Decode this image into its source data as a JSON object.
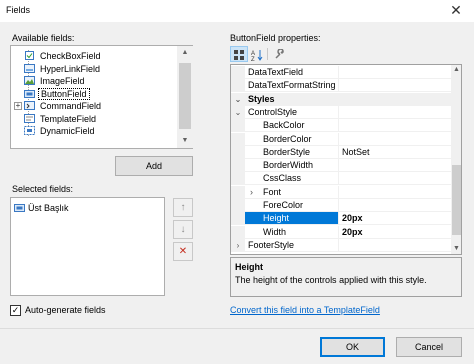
{
  "window": {
    "title": "Fields",
    "close_glyph": "✕"
  },
  "available": {
    "label": "Available fields:",
    "items": [
      {
        "label": "CheckBoxField",
        "icon": "checkbox-field-icon",
        "expandable": false,
        "selected": false
      },
      {
        "label": "HyperLinkField",
        "icon": "hyperlink-field-icon",
        "expandable": false,
        "selected": false
      },
      {
        "label": "ImageField",
        "icon": "image-field-icon",
        "expandable": false,
        "selected": false
      },
      {
        "label": "ButtonField",
        "icon": "button-field-icon",
        "expandable": false,
        "selected": true
      },
      {
        "label": "CommandField",
        "icon": "command-field-icon",
        "expandable": true,
        "selected": false
      },
      {
        "label": "TemplateField",
        "icon": "template-field-icon",
        "expandable": false,
        "selected": false
      },
      {
        "label": "DynamicField",
        "icon": "dynamic-field-icon",
        "expandable": false,
        "selected": false
      }
    ],
    "add_label": "Add"
  },
  "selected": {
    "label": "Selected fields:",
    "items": [
      {
        "label": "Üst Başlık",
        "icon": "button-field-icon"
      }
    ],
    "move_up": "↑",
    "move_down": "↓",
    "delete": "✕"
  },
  "autogen": {
    "label": "Auto-generate fields",
    "checked": true
  },
  "properties": {
    "label": "ButtonField properties:",
    "rows": [
      {
        "type": "prop",
        "name": "DataTextField",
        "value": ""
      },
      {
        "type": "prop",
        "name": "DataTextFormatString",
        "value": ""
      },
      {
        "type": "cat",
        "name": "Styles",
        "chevron": "⌄"
      },
      {
        "type": "prop",
        "name": "ControlStyle",
        "value": "",
        "chevron": "⌄"
      },
      {
        "type": "prop",
        "name": "BackColor",
        "value": "",
        "indent": true
      },
      {
        "type": "prop",
        "name": "BorderColor",
        "value": "",
        "indent": true
      },
      {
        "type": "prop",
        "name": "BorderStyle",
        "value": "NotSet",
        "indent": true
      },
      {
        "type": "prop",
        "name": "BorderWidth",
        "value": "",
        "indent": true
      },
      {
        "type": "prop",
        "name": "CssClass",
        "value": "",
        "indent": true
      },
      {
        "type": "prop",
        "name": "Font",
        "value": "",
        "indent": true,
        "chevron": "›"
      },
      {
        "type": "prop",
        "name": "ForeColor",
        "value": "",
        "indent": true
      },
      {
        "type": "prop",
        "name": "Height",
        "value": "20px",
        "indent": true,
        "selected": true,
        "bold": true
      },
      {
        "type": "prop",
        "name": "Width",
        "value": "20px",
        "indent": true,
        "bold": true
      },
      {
        "type": "prop",
        "name": "FooterStyle",
        "value": "",
        "chevron": "›"
      }
    ],
    "desc_title": "Height",
    "desc_text": "The height of the controls applied with this style."
  },
  "convert_link": "Convert this field into a TemplateField",
  "ok_label": "OK",
  "cancel_label": "Cancel",
  "colors": {
    "accent": "#0078d7",
    "link": "#0066cc",
    "delete": "#c42b1c"
  }
}
